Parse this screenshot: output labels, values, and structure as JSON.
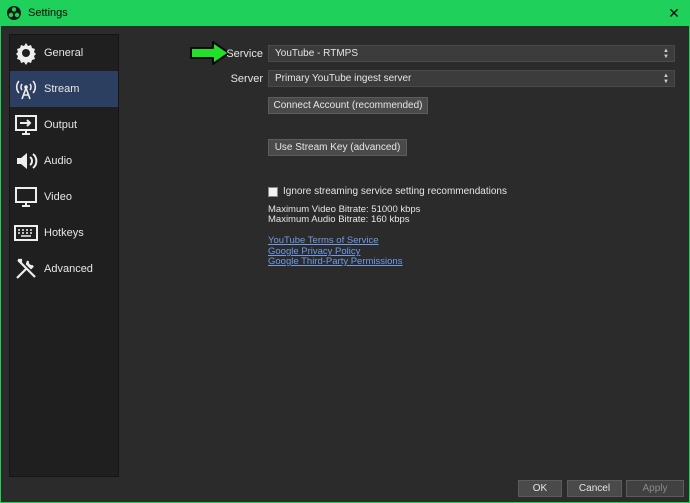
{
  "window": {
    "title": "Settings",
    "close_glyph": "✕"
  },
  "sidebar": {
    "items": [
      {
        "label": "General",
        "icon": "gear-icon"
      },
      {
        "label": "Stream",
        "icon": "antenna-icon",
        "active": true
      },
      {
        "label": "Output",
        "icon": "output-icon"
      },
      {
        "label": "Audio",
        "icon": "speaker-icon"
      },
      {
        "label": "Video",
        "icon": "monitor-icon"
      },
      {
        "label": "Hotkeys",
        "icon": "keyboard-icon"
      },
      {
        "label": "Advanced",
        "icon": "tools-icon"
      }
    ]
  },
  "stream": {
    "service_label": "Service",
    "service_value": "YouTube - RTMPS",
    "server_label": "Server",
    "server_value": "Primary YouTube ingest server",
    "connect_button": "Connect Account (recommended)",
    "stream_key_button": "Use Stream Key (advanced)",
    "ignore_checkbox_label": "Ignore streaming service setting recommendations",
    "ignore_checked": false,
    "max_video_bitrate": "Maximum Video Bitrate: 51000 kbps",
    "max_audio_bitrate": "Maximum Audio Bitrate: 160 kbps",
    "links": [
      "YouTube Terms of Service",
      "Google Privacy Policy",
      "Google Third-Party Permissions"
    ]
  },
  "footer": {
    "ok": "OK",
    "cancel": "Cancel",
    "apply": "Apply"
  },
  "colors": {
    "titlebar": "#1fd05a",
    "accent_arrow": "#22e02a",
    "active_item": "#2c3f60",
    "link": "#6f9ce8"
  }
}
